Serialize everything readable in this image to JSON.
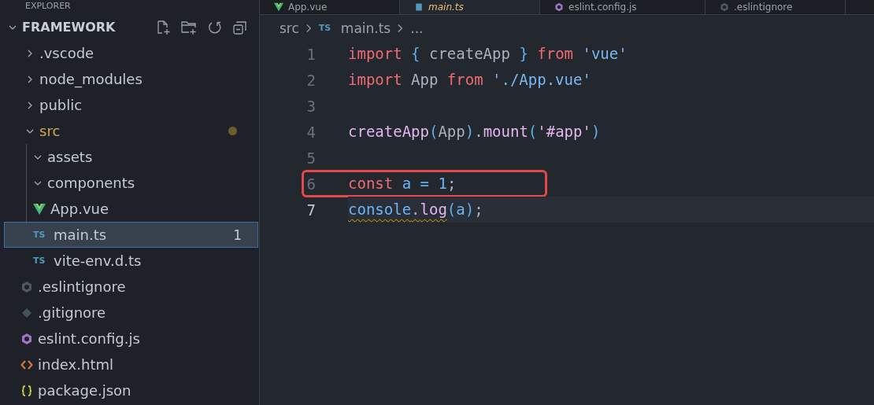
{
  "sidebar": {
    "title": "EXPLORER",
    "project": {
      "label": "FRAMEWORK",
      "expanded": true
    },
    "items": [
      {
        "label": ".vscode",
        "kind": "folder",
        "expanded": false
      },
      {
        "label": "node_modules",
        "kind": "folder",
        "expanded": false
      },
      {
        "label": "public",
        "kind": "folder",
        "expanded": false
      },
      {
        "label": "src",
        "kind": "folder",
        "expanded": true,
        "modified": true,
        "children": [
          {
            "label": "assets",
            "kind": "folder",
            "expanded": true
          },
          {
            "label": "components",
            "kind": "folder",
            "expanded": true
          },
          {
            "label": "App.vue",
            "kind": "vue",
            "selected": false
          },
          {
            "label": "main.ts",
            "kind": "ts",
            "badge": "TS",
            "selected": true,
            "problems": "1"
          },
          {
            "label": "vite-env.d.ts",
            "kind": "ts",
            "badge": "TS",
            "selected": false
          }
        ]
      },
      {
        "label": ".eslintignore",
        "kind": "ignore",
        "selected": false
      },
      {
        "label": ".gitignore",
        "kind": "git",
        "selected": false
      },
      {
        "label": "eslint.config.js",
        "kind": "eslint",
        "selected": false
      },
      {
        "label": "index.html",
        "kind": "html",
        "selected": false
      },
      {
        "label": "package.json",
        "kind": "json",
        "selected": false
      }
    ]
  },
  "tabs": [
    {
      "label": "App.vue",
      "kind": "vue",
      "selected": false
    },
    {
      "label": "main.ts",
      "kind": "ts",
      "selected": true
    },
    {
      "label": "eslint.config.js",
      "kind": "eslint",
      "selected": false
    },
    {
      "label": ".eslintignore",
      "kind": "ignore",
      "selected": false
    }
  ],
  "breadcrumb": [
    {
      "label": "src"
    },
    {
      "label": "main.ts",
      "badge": "TS"
    },
    {
      "label": "..."
    }
  ],
  "code": {
    "lines": [
      {
        "number": "1",
        "tokens": [
          {
            "text": "import ",
            "kind": "keyword"
          },
          {
            "text": "{",
            "kind": "punct"
          },
          {
            "text": " createApp ",
            "kind": "plain"
          },
          {
            "text": "}",
            "kind": "punct"
          },
          {
            "text": " from ",
            "kind": "keyword"
          },
          {
            "text": "'vue'",
            "kind": "string"
          }
        ]
      },
      {
        "number": "2",
        "tokens": [
          {
            "text": "import ",
            "kind": "keyword"
          },
          {
            "text": "App ",
            "kind": "plain"
          },
          {
            "text": "from ",
            "kind": "keyword"
          },
          {
            "text": "'./App.vue'",
            "kind": "string"
          }
        ]
      },
      {
        "number": "3"
      },
      {
        "number": "4",
        "tokens": [
          {
            "text": "createApp",
            "kind": "function"
          },
          {
            "text": "(",
            "kind": "punct"
          },
          {
            "text": "App",
            "kind": "plain"
          },
          {
            "text": ")",
            "kind": "punct"
          },
          {
            "text": ".",
            "kind": "plain"
          },
          {
            "text": "mount",
            "kind": "function"
          },
          {
            "text": "(",
            "kind": "punct"
          },
          {
            "text": "'#app'",
            "kind": "function"
          },
          {
            "text": ")",
            "kind": "punct"
          }
        ]
      },
      {
        "number": "5"
      },
      {
        "number": "6",
        "boxed": true,
        "tokens": [
          {
            "text": "const ",
            "kind": "keyword"
          },
          {
            "text": "a ",
            "kind": "variable"
          },
          {
            "text": "= ",
            "kind": "punct"
          },
          {
            "text": "1",
            "kind": "variable"
          },
          {
            "text": ";",
            "kind": "plain"
          }
        ]
      },
      {
        "number": "7",
        "current": true,
        "tokens": [
          {
            "text": "console",
            "kind": "variable",
            "warning": true
          },
          {
            "text": ".",
            "kind": "plain",
            "warning": true
          },
          {
            "text": "log",
            "kind": "function",
            "warning": true
          },
          {
            "text": "(",
            "kind": "punct"
          },
          {
            "text": "a",
            "kind": "variable"
          },
          {
            "text": ")",
            "kind": "punct"
          },
          {
            "text": ";",
            "kind": "plain"
          }
        ]
      }
    ]
  }
}
